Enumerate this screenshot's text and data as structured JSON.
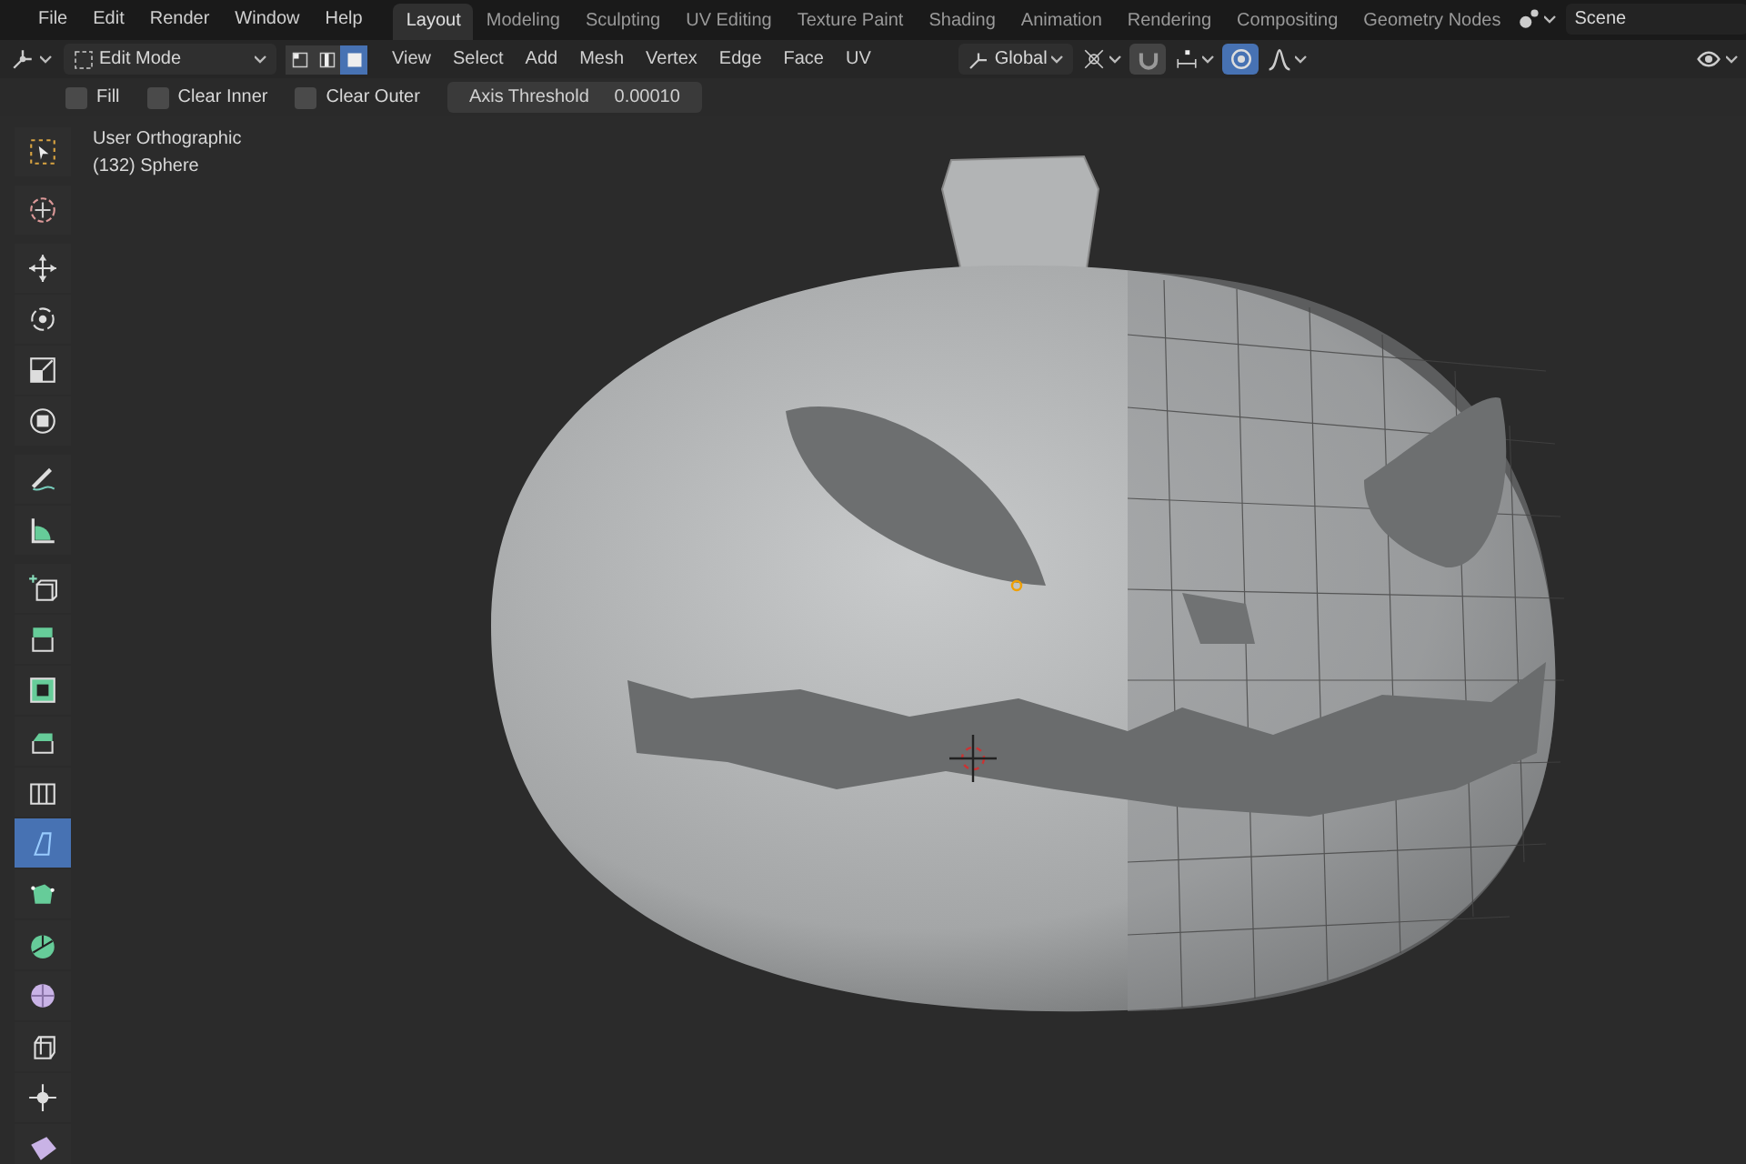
{
  "topbar": {
    "menus": [
      "File",
      "Edit",
      "Render",
      "Window",
      "Help"
    ],
    "workspaces": [
      {
        "label": "Layout",
        "selected": true
      },
      {
        "label": "Modeling",
        "selected": false
      },
      {
        "label": "Sculpting",
        "selected": false
      },
      {
        "label": "UV Editing",
        "selected": false
      },
      {
        "label": "Texture Paint",
        "selected": false
      },
      {
        "label": "Shading",
        "selected": false
      },
      {
        "label": "Animation",
        "selected": false
      },
      {
        "label": "Rendering",
        "selected": false
      },
      {
        "label": "Compositing",
        "selected": false
      },
      {
        "label": "Geometry Nodes",
        "selected": false
      }
    ],
    "scene": "Scene"
  },
  "header": {
    "mode": "Edit Mode",
    "select_modes": [
      {
        "selected": false
      },
      {
        "selected": false
      },
      {
        "selected": true
      }
    ],
    "menus": [
      "View",
      "Select",
      "Add",
      "Mesh",
      "Vertex",
      "Edge",
      "Face",
      "UV"
    ],
    "orientation": "Global",
    "proportional_editing": true
  },
  "tool_settings": {
    "checkboxes": [
      {
        "label": "Fill",
        "checked": false
      },
      {
        "label": "Clear Inner",
        "checked": false
      },
      {
        "label": "Clear Outer",
        "checked": false
      }
    ],
    "field": {
      "label": "Axis Threshold",
      "value": "0.00010"
    }
  },
  "toolbar": [
    {
      "selected": false
    },
    {
      "selected": false
    },
    {
      "selected": false
    },
    {
      "selected": false
    },
    {
      "selected": false
    },
    {
      "selected": false
    },
    {
      "selected": false
    },
    {
      "selected": false
    },
    {
      "selected": false
    },
    {
      "selected": false
    },
    {
      "selected": false
    },
    {
      "selected": false
    },
    {
      "selected": false
    },
    {
      "selected": true
    },
    {
      "selected": false
    },
    {
      "selected": false
    },
    {
      "selected": false
    },
    {
      "selected": false
    },
    {
      "selected": false
    },
    {
      "selected": false
    }
  ],
  "viewport": {
    "view": "User Orthographic",
    "object": "(132) Sphere"
  }
}
